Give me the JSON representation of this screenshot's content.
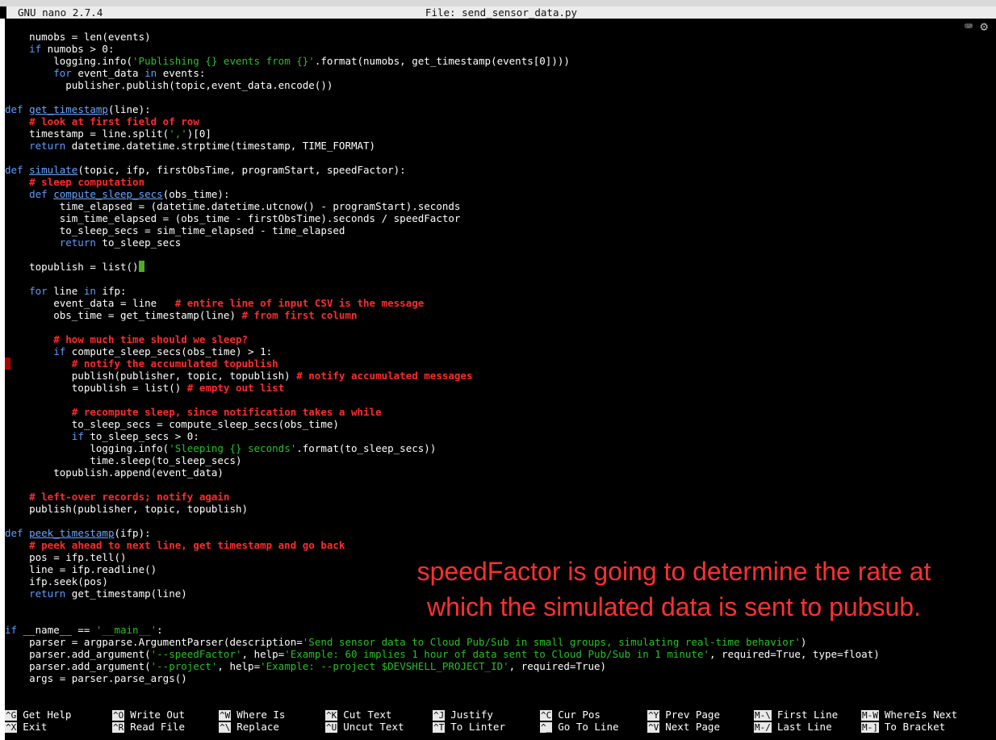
{
  "window": {
    "app_title": "GNU nano 2.7.4",
    "file_title": "File: send_sensor_data.py"
  },
  "toolbar_icons": [
    "keyboard-icon",
    "gear-icon"
  ],
  "code_lines": [
    [
      [
        "",
        "    numobs = len(events)"
      ]
    ],
    [
      [
        "kw",
        "    if"
      ],
      [
        "",
        " numobs > 0:"
      ]
    ],
    [
      [
        "",
        "        logging.info("
      ],
      [
        "str",
        "'Publishing {} events from {}'"
      ],
      [
        "",
        ".format(numobs, get_timestamp(events[0])))"
      ]
    ],
    [
      [
        "",
        "        "
      ],
      [
        "kw",
        "for"
      ],
      [
        "",
        " event_data "
      ],
      [
        "kw",
        "in"
      ],
      [
        "",
        " events:"
      ]
    ],
    [
      [
        "",
        "          publisher.publish(topic,event_data.encode())"
      ]
    ],
    [
      [
        "",
        ""
      ]
    ],
    [
      [
        "kw",
        "def"
      ],
      [
        "",
        " "
      ],
      [
        "fn",
        "get_timestamp"
      ],
      [
        "",
        "(line):"
      ]
    ],
    [
      [
        "",
        "    "
      ],
      [
        "cm",
        "# look at first field of row"
      ]
    ],
    [
      [
        "",
        "    timestamp = line.split("
      ],
      [
        "str",
        "','"
      ],
      [
        "",
        ")[0]"
      ]
    ],
    [
      [
        "kw",
        "    return"
      ],
      [
        "",
        " datetime.datetime.strptime(timestamp, TIME_FORMAT)"
      ]
    ],
    [
      [
        "",
        ""
      ]
    ],
    [
      [
        "kw",
        "def"
      ],
      [
        "",
        " "
      ],
      [
        "fn",
        "simulate"
      ],
      [
        "",
        "(topic, ifp, firstObsTime, programStart, speedFactor):"
      ]
    ],
    [
      [
        "",
        "    "
      ],
      [
        "cm",
        "# sleep computation"
      ]
    ],
    [
      [
        "",
        "    "
      ],
      [
        "kw",
        "def"
      ],
      [
        "",
        " "
      ],
      [
        "fn",
        "compute_sleep_secs"
      ],
      [
        "",
        "(obs_time):"
      ]
    ],
    [
      [
        "",
        "         time_elapsed = (datetime.datetime.utcnow() - programStart).seconds"
      ]
    ],
    [
      [
        "",
        "         sim_time_elapsed = (obs_time - firstObsTime).seconds / speedFactor"
      ]
    ],
    [
      [
        "",
        "         to_sleep_secs = sim_time_elapsed - time_elapsed"
      ]
    ],
    [
      [
        "",
        "         "
      ],
      [
        "kw",
        "return"
      ],
      [
        "",
        " to_sleep_secs"
      ]
    ],
    [
      [
        "",
        ""
      ]
    ],
    [
      [
        "",
        "    topublish = list()"
      ],
      [
        "cursor",
        ""
      ]
    ],
    [
      [
        "",
        ""
      ]
    ],
    [
      [
        "",
        "    "
      ],
      [
        "kw",
        "for"
      ],
      [
        "",
        " line "
      ],
      [
        "kw",
        "in"
      ],
      [
        "",
        " ifp:"
      ]
    ],
    [
      [
        "",
        "        event_data = line   "
      ],
      [
        "cm",
        "# entire line of input CSV is the message"
      ]
    ],
    [
      [
        "",
        "        obs_time = get_timestamp(line) "
      ],
      [
        "cm",
        "# from first column"
      ]
    ],
    [
      [
        "",
        ""
      ]
    ],
    [
      [
        "",
        "        "
      ],
      [
        "cm",
        "# how much time should we sleep?"
      ]
    ],
    [
      [
        "",
        "        "
      ],
      [
        "kw",
        "if"
      ],
      [
        "",
        " compute_sleep_secs(obs_time) > 1:"
      ]
    ],
    [
      [
        "",
        "           "
      ],
      [
        "cm",
        "# notify the accumulated topublish"
      ]
    ],
    [
      [
        "",
        "           publish(publisher, topic, topublish) "
      ],
      [
        "cm",
        "# notify accumulated messages"
      ]
    ],
    [
      [
        "",
        "           topublish = list() "
      ],
      [
        "cm",
        "# empty out list"
      ]
    ],
    [
      [
        "",
        ""
      ]
    ],
    [
      [
        "",
        "           "
      ],
      [
        "cm",
        "# recompute sleep, since notification takes a while"
      ]
    ],
    [
      [
        "",
        "           to_sleep_secs = compute_sleep_secs(obs_time)"
      ]
    ],
    [
      [
        "",
        "           "
      ],
      [
        "kw",
        "if"
      ],
      [
        "",
        " to_sleep_secs > 0:"
      ]
    ],
    [
      [
        "",
        "              logging.info("
      ],
      [
        "str",
        "'Sleeping {} seconds'"
      ],
      [
        "",
        ".format(to_sleep_secs))"
      ]
    ],
    [
      [
        "",
        "              time.sleep(to_sleep_secs)"
      ]
    ],
    [
      [
        "",
        "        topublish.append(event_data)"
      ]
    ],
    [
      [
        "",
        ""
      ]
    ],
    [
      [
        "",
        "    "
      ],
      [
        "cm",
        "# left-over records; notify again"
      ]
    ],
    [
      [
        "",
        "    publish(publisher, topic, topublish)"
      ]
    ],
    [
      [
        "",
        ""
      ]
    ],
    [
      [
        "kw",
        "def"
      ],
      [
        "",
        " "
      ],
      [
        "fn",
        "peek_timestamp"
      ],
      [
        "",
        "(ifp):"
      ]
    ],
    [
      [
        "",
        "    "
      ],
      [
        "cm",
        "# peek ahead to next line, get timestamp and go back"
      ]
    ],
    [
      [
        "",
        "    pos = ifp.tell()"
      ]
    ],
    [
      [
        "",
        "    line = ifp.readline()"
      ]
    ],
    [
      [
        "",
        "    ifp.seek(pos)"
      ]
    ],
    [
      [
        "kw",
        "    return"
      ],
      [
        "",
        " get_timestamp(line)"
      ]
    ],
    [
      [
        "",
        ""
      ]
    ],
    [
      [
        "",
        ""
      ]
    ],
    [
      [
        "kw",
        "if"
      ],
      [
        "",
        " __name__ == "
      ],
      [
        "str",
        "'__main__'"
      ],
      [
        "",
        ":"
      ]
    ],
    [
      [
        "",
        "    parser = argparse.ArgumentParser(description="
      ],
      [
        "str",
        "'Send sensor data to Cloud Pub/Sub in small groups, simulating real-time behavior'"
      ],
      [
        "",
        ")"
      ]
    ],
    [
      [
        "",
        "    parser.add_argument("
      ],
      [
        "str",
        "'--speedFactor'"
      ],
      [
        "",
        ", help="
      ],
      [
        "str",
        "'Example: 60 implies 1 hour of data sent to Cloud Pub/Sub in 1 minute'"
      ],
      [
        "",
        ", required=True, type=float)"
      ]
    ],
    [
      [
        "",
        "    parser.add_argument("
      ],
      [
        "str",
        "'--project'"
      ],
      [
        "",
        ", help="
      ],
      [
        "str",
        "'Example: --project $DEVSHELL_PROJECT_ID'"
      ],
      [
        "",
        ", required=True)"
      ]
    ],
    [
      [
        "",
        "    args = parser.parse_args()"
      ]
    ]
  ],
  "annotation": {
    "line1": "speedFactor is going to determine the rate at",
    "line2": "which the simulated data is sent to pubsub."
  },
  "shortcuts": [
    {
      "key": "^G",
      "label": "Get Help"
    },
    {
      "key": "^X",
      "label": "Exit"
    },
    {
      "key": "^O",
      "label": "Write Out"
    },
    {
      "key": "^R",
      "label": "Read File"
    },
    {
      "key": "^W",
      "label": "Where Is"
    },
    {
      "key": "^\\",
      "label": "Replace"
    },
    {
      "key": "^K",
      "label": "Cut Text"
    },
    {
      "key": "^U",
      "label": "Uncut Text"
    },
    {
      "key": "^J",
      "label": "Justify"
    },
    {
      "key": "^T",
      "label": "To Linter"
    },
    {
      "key": "^C",
      "label": "Cur Pos"
    },
    {
      "key": "^_",
      "label": "Go To Line"
    },
    {
      "key": "^Y",
      "label": "Prev Page"
    },
    {
      "key": "^V",
      "label": "Next Page"
    },
    {
      "key": "M-\\",
      "label": "First Line"
    },
    {
      "key": "M-/",
      "label": "Last Line"
    },
    {
      "key": "M-W",
      "label": "WhereIs Next"
    },
    {
      "key": "M-]",
      "label": "To Bracket"
    }
  ]
}
